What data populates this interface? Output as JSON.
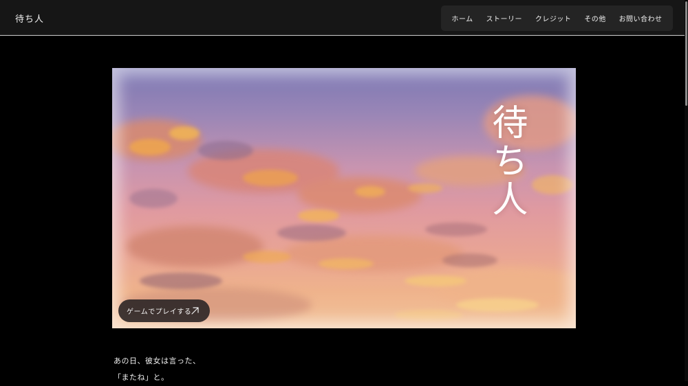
{
  "header": {
    "site_title": "待ち人",
    "nav": [
      {
        "label": "ホーム"
      },
      {
        "label": "ストーリー"
      },
      {
        "label": "クレジット"
      },
      {
        "label": "その他"
      },
      {
        "label": "お問い合わせ"
      }
    ]
  },
  "hero": {
    "title": "待ち人",
    "play_button_label": "ゲームでプレイする",
    "play_button_icon": "arrow-up-right-icon"
  },
  "story": {
    "lines": [
      "あの日、彼女は言った、",
      "「またね」と。"
    ]
  },
  "colors": {
    "background": "#000000",
    "header": "#161616",
    "nav_bg": "#242424",
    "sky_top": "#7c78b4",
    "sky_bottom": "#f2c39a"
  }
}
